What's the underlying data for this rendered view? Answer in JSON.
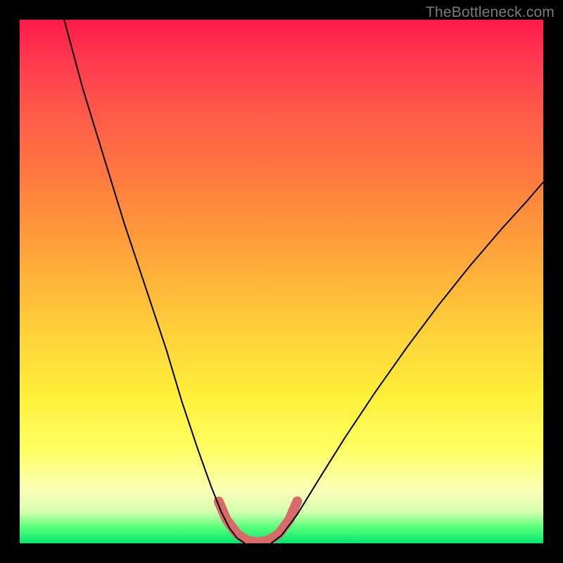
{
  "watermark": "TheBottleneck.com",
  "chart_data": {
    "type": "line",
    "title": "",
    "xlabel": "",
    "ylabel": "",
    "xlim": [
      0,
      1
    ],
    "ylim": [
      0,
      1
    ],
    "background_gradient": {
      "top_color": "#ff1a4a",
      "mid_color": "#ffe23a",
      "bottom_color": "#00e670"
    },
    "series": [
      {
        "name": "left-curve",
        "stroke": "#000000",
        "stroke_width": 2,
        "points": [
          {
            "x": 0.085,
            "y": 1.0
          },
          {
            "x": 0.12,
            "y": 0.87
          },
          {
            "x": 0.16,
            "y": 0.74
          },
          {
            "x": 0.2,
            "y": 0.61
          },
          {
            "x": 0.24,
            "y": 0.49
          },
          {
            "x": 0.28,
            "y": 0.37
          },
          {
            "x": 0.31,
            "y": 0.27
          },
          {
            "x": 0.34,
            "y": 0.18
          },
          {
            "x": 0.365,
            "y": 0.11
          },
          {
            "x": 0.385,
            "y": 0.06
          },
          {
            "x": 0.4,
            "y": 0.03
          },
          {
            "x": 0.415,
            "y": 0.01
          },
          {
            "x": 0.43,
            "y": 0.0
          }
        ]
      },
      {
        "name": "right-curve",
        "stroke": "#000000",
        "stroke_width": 2,
        "points": [
          {
            "x": 0.48,
            "y": 0.0
          },
          {
            "x": 0.5,
            "y": 0.015
          },
          {
            "x": 0.53,
            "y": 0.055
          },
          {
            "x": 0.57,
            "y": 0.12
          },
          {
            "x": 0.62,
            "y": 0.2
          },
          {
            "x": 0.68,
            "y": 0.29
          },
          {
            "x": 0.74,
            "y": 0.375
          },
          {
            "x": 0.8,
            "y": 0.455
          },
          {
            "x": 0.86,
            "y": 0.53
          },
          {
            "x": 0.92,
            "y": 0.6
          },
          {
            "x": 0.97,
            "y": 0.655
          },
          {
            "x": 1.0,
            "y": 0.69
          }
        ]
      },
      {
        "name": "bottom-u-highlight",
        "stroke": "#d96a6a",
        "stroke_width": 14,
        "linecap": "round",
        "points": [
          {
            "x": 0.38,
            "y": 0.08
          },
          {
            "x": 0.395,
            "y": 0.045
          },
          {
            "x": 0.415,
            "y": 0.018
          },
          {
            "x": 0.435,
            "y": 0.005
          },
          {
            "x": 0.455,
            "y": 0.002
          },
          {
            "x": 0.475,
            "y": 0.005
          },
          {
            "x": 0.495,
            "y": 0.018
          },
          {
            "x": 0.515,
            "y": 0.045
          },
          {
            "x": 0.53,
            "y": 0.08
          }
        ]
      }
    ]
  }
}
